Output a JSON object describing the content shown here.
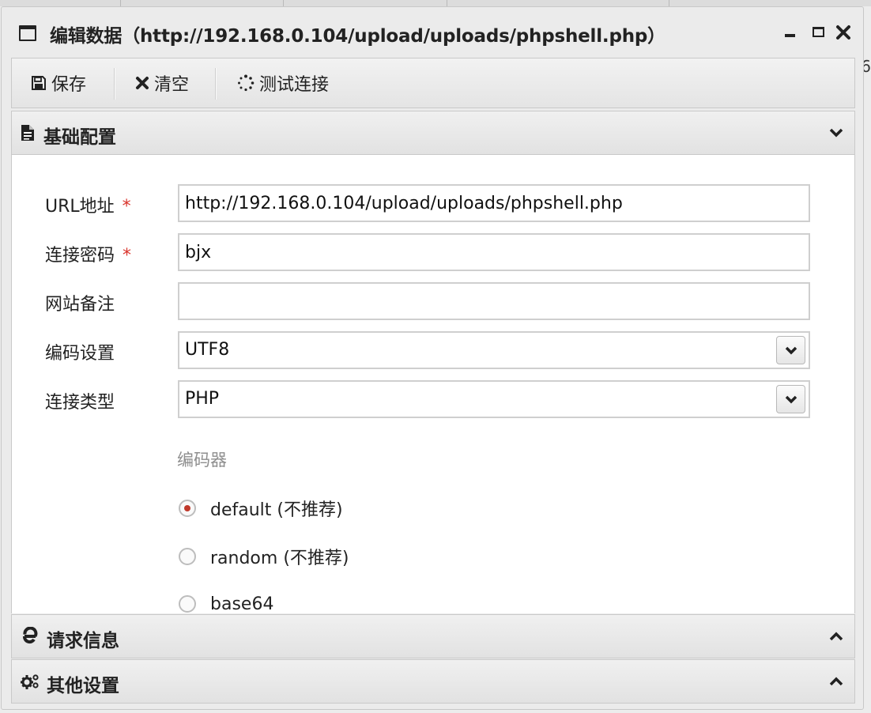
{
  "window": {
    "title": "编辑数据（http://192.168.0.104/upload/uploads/phpshell.php）",
    "side_char": "6"
  },
  "toolbar": {
    "save_label": "保存",
    "clear_label": "清空",
    "test_label": "测试连接"
  },
  "panels": {
    "basic": {
      "title": "基础配置",
      "state": "expanded"
    },
    "request": {
      "title": "请求信息",
      "state": "collapsed"
    },
    "other": {
      "title": "其他设置",
      "state": "collapsed"
    }
  },
  "form": {
    "url": {
      "label": "URL地址",
      "required_mark": "*",
      "value": "http://192.168.0.104/upload/uploads/phpshell.php"
    },
    "password": {
      "label": "连接密码",
      "required_mark": "*",
      "value": "bjx"
    },
    "note": {
      "label": "网站备注",
      "value": ""
    },
    "encoding": {
      "label": "编码设置",
      "value": "UTF8"
    },
    "type": {
      "label": "连接类型",
      "value": "PHP"
    },
    "encoder": {
      "label": "编码器",
      "options": [
        {
          "label": "default (不推荐)",
          "checked": true
        },
        {
          "label": "random (不推荐)",
          "checked": false
        },
        {
          "label": "base64",
          "checked": false
        }
      ]
    }
  },
  "colors": {
    "required": "#d9332b",
    "radio_dot": "#c0392b",
    "muted": "#8e8e8e"
  }
}
